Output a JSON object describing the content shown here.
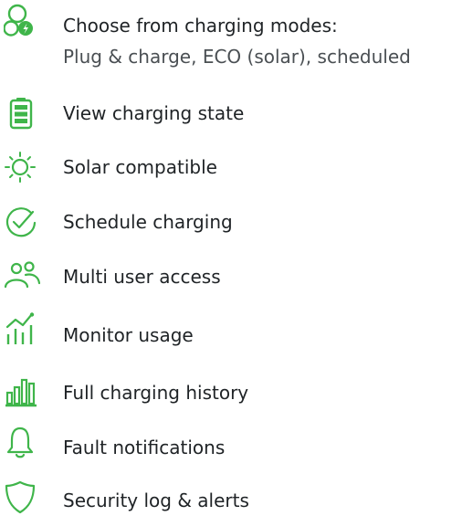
{
  "colors": {
    "accent": "#3fb54a",
    "text": "#1f2326",
    "subtext": "#4a4f53"
  },
  "features": [
    {
      "label": "Choose from charging modes:",
      "sublabel": "Plug & charge, ECO (solar), scheduled",
      "icon": "charging-modes-icon"
    },
    {
      "label": "View charging state",
      "icon": "battery-icon"
    },
    {
      "label": "Solar compatible",
      "icon": "sun-icon"
    },
    {
      "label": "Schedule charging",
      "icon": "clock-check-icon"
    },
    {
      "label": "Multi user access",
      "icon": "users-icon"
    },
    {
      "label": "Monitor usage",
      "icon": "usage-graph-icon"
    },
    {
      "label": "Full charging history",
      "icon": "bar-chart-icon"
    },
    {
      "label": "Fault notifications",
      "icon": "bell-icon"
    },
    {
      "label": "Security log & alerts",
      "icon": "shield-icon"
    }
  ]
}
